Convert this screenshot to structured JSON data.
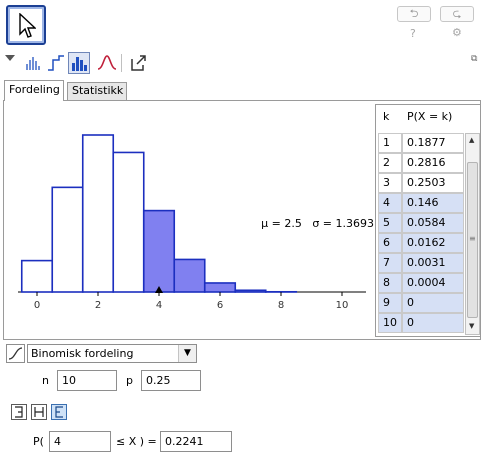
{
  "toolbar": {
    "move_tool": "move-tool",
    "help_label": "?"
  },
  "tabs": [
    {
      "label": "Fordeling"
    },
    {
      "label": "Statistikk"
    }
  ],
  "chart_data": {
    "type": "bar",
    "x": [
      0,
      1,
      2,
      3,
      4,
      5,
      6,
      7,
      8,
      9,
      10
    ],
    "values": [
      0.0563,
      0.1877,
      0.2816,
      0.2503,
      0.146,
      0.0584,
      0.0162,
      0.0031,
      0.0004,
      0.0,
      0.0
    ],
    "highlight_from": 4,
    "xticks": [
      "0",
      "2",
      "4",
      "6",
      "8",
      "10"
    ],
    "xlim": [
      -1,
      11
    ],
    "bar_color": "#ffffff",
    "highlight_color": "#8080f0",
    "edge_color": "#1c2fbf",
    "marker_x": 4
  },
  "stats": {
    "mu": "μ = 2.5",
    "sigma": "σ = 1.3693"
  },
  "table": {
    "headers": [
      "k",
      "P(X = k)"
    ],
    "rows": [
      {
        "k": "1",
        "p": "0.1877"
      },
      {
        "k": "2",
        "p": "0.2816"
      },
      {
        "k": "3",
        "p": "0.2503"
      },
      {
        "k": "4",
        "p": "0.146"
      },
      {
        "k": "5",
        "p": "0.0584"
      },
      {
        "k": "6",
        "p": "0.0162"
      },
      {
        "k": "7",
        "p": "0.0031"
      },
      {
        "k": "8",
        "p": "0.0004"
      },
      {
        "k": "9",
        "p": "0"
      },
      {
        "k": "10",
        "p": "0"
      }
    ]
  },
  "controls": {
    "distribution": "Binomisk fordeling",
    "n_label": "n",
    "n_value": "10",
    "p_label": "p",
    "p_value": "0.25",
    "prob_prefix": "P(",
    "prob_k": "4",
    "prob_relation": "≤ X ) =",
    "prob_result": "0.2241"
  }
}
